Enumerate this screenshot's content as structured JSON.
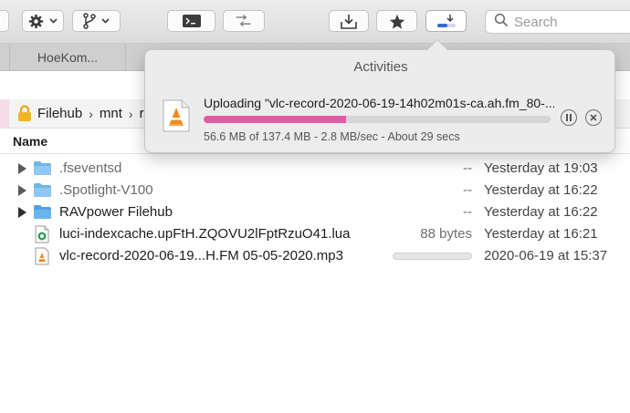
{
  "colors": {
    "accent_pink": "#e65aa3",
    "toolbar_bg": "#dcdcdc",
    "popover_bg": "#ececec"
  },
  "toolbar": {
    "icons": [
      "gear-icon",
      "branch-icon",
      "terminal-icon",
      "transfer-icon",
      "download-tray-icon",
      "star-icon",
      "activities-icon"
    ],
    "search_placeholder": "Search"
  },
  "tabs": [
    {
      "label": "HoeKom..."
    }
  ],
  "path": {
    "items": [
      "Filehub",
      "mnt",
      "r"
    ]
  },
  "columns": {
    "name": "Name"
  },
  "files": [
    {
      "name": ".fseventsd",
      "size": "--",
      "date": "Yesterday at 19:03",
      "type": "folder",
      "expandable": true,
      "dim": true
    },
    {
      "name": ".Spotlight-V100",
      "size": "--",
      "date": "Yesterday at 16:22",
      "type": "folder",
      "expandable": true,
      "dim": true
    },
    {
      "name": "RAVpower Filehub",
      "size": "--",
      "date": "Yesterday at 16:22",
      "type": "folder",
      "expandable": true,
      "dim": false
    },
    {
      "name": "luci-indexcache.upFtH.ZQOVU2lFptRzuO41.lua",
      "size": "88 bytes",
      "date": "Yesterday at 16:21",
      "type": "lua-file",
      "expandable": false,
      "dim": false
    },
    {
      "name": "vlc-record-2020-06-19...H.FM 05-05-2020.mp3",
      "size": "",
      "date": "2020-06-19 at 15:37",
      "type": "vlc-file",
      "expandable": false,
      "dim": false,
      "progress": 0.0
    }
  ],
  "activities": {
    "title": "Activities",
    "upload_title": "Uploading \"vlc-record-2020-06-19-14h02m01s-ca.ah.fm_80-...",
    "progress": 0.41,
    "status": "56.6 MB of 137.4 MB - 2.8 MB/sec - About 29 secs",
    "pause_icon": "pause-icon",
    "cancel_icon": "cancel-icon"
  }
}
